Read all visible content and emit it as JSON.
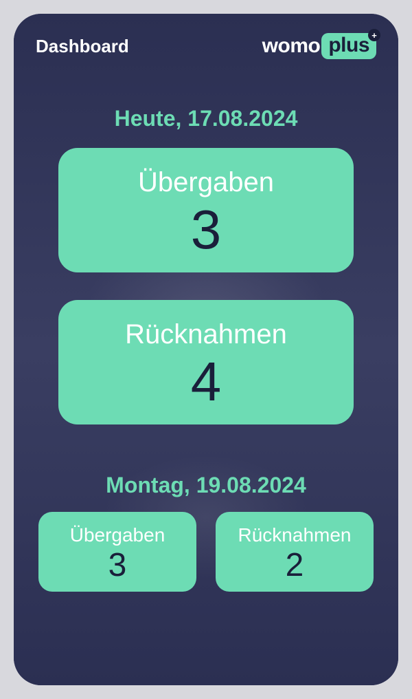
{
  "header": {
    "title": "Dashboard",
    "logo": {
      "prefix": "womo",
      "suffix": "plus",
      "badge_icon": "+"
    }
  },
  "today": {
    "heading": "Heute, 17.08.2024",
    "handovers": {
      "label": "Übergaben",
      "value": "3"
    },
    "returns": {
      "label": "Rücknahmen",
      "value": "4"
    }
  },
  "next_day": {
    "heading": "Montag, 19.08.2024",
    "handovers": {
      "label": "Übergaben",
      "value": "3"
    },
    "returns": {
      "label": "Rücknahmen",
      "value": "2"
    }
  },
  "colors": {
    "accent": "#6ddcb4",
    "dark": "#1a1f3a",
    "background": "#2b2f52"
  }
}
